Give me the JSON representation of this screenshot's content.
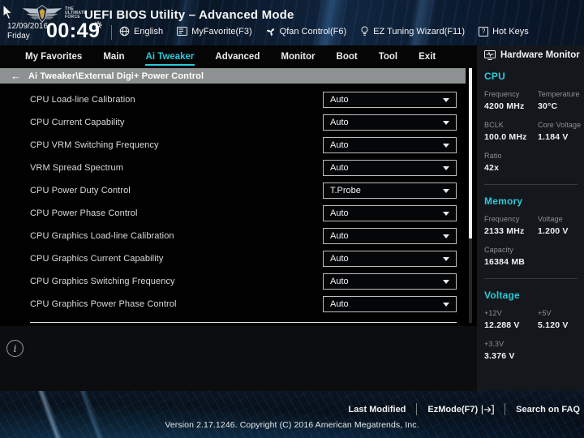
{
  "colors": {
    "accent": "#2bc9da",
    "breadcrumb_bg": "#8e9192",
    "panel_bg": "#010101",
    "sidebar_bg": "#14171b"
  },
  "header": {
    "logo_text": "THE ULTIMATE FORCE",
    "title": "UEFI BIOS Utility – Advanced Mode",
    "date": "12/09/2016",
    "day": "Friday",
    "time": "00:49",
    "actions": [
      {
        "label": "English",
        "icon": "globe-icon"
      },
      {
        "label": "MyFavorite(F3)",
        "icon": "myfavorite-icon"
      },
      {
        "label": "Qfan Control(F6)",
        "icon": "fan-icon"
      },
      {
        "label": "EZ Tuning Wizard(F11)",
        "icon": "bulb-icon"
      },
      {
        "label": "Hot Keys",
        "icon": "question-icon"
      }
    ],
    "question_glyph": "?"
  },
  "menu": {
    "tabs": [
      {
        "label": "My Favorites"
      },
      {
        "label": "Main"
      },
      {
        "label": "Ai Tweaker",
        "active": true
      },
      {
        "label": "Advanced"
      },
      {
        "label": "Monitor"
      },
      {
        "label": "Boot"
      },
      {
        "label": "Tool"
      },
      {
        "label": "Exit"
      }
    ]
  },
  "breadcrumb": {
    "back_icon": "←",
    "path": "Ai Tweaker\\External Digi+ Power Control"
  },
  "settings": {
    "rows": [
      {
        "label": "CPU Load-line Calibration",
        "value": "Auto"
      },
      {
        "label": "CPU Current Capability",
        "value": "Auto"
      },
      {
        "label": "CPU VRM Switching Frequency",
        "value": "Auto"
      },
      {
        "label": "VRM Spread Spectrum",
        "value": "Auto"
      },
      {
        "label": "CPU Power Duty Control",
        "value": "T.Probe"
      },
      {
        "label": "CPU Power Phase Control",
        "value": "Auto"
      },
      {
        "label": "CPU Graphics Load-line Calibration",
        "value": "Auto"
      },
      {
        "label": "CPU Graphics Current Capability",
        "value": "Auto"
      },
      {
        "label": "CPU Graphics Switching Frequency",
        "value": "Auto"
      },
      {
        "label": "CPU Graphics Power Phase Control",
        "value": "Auto"
      }
    ]
  },
  "info": {
    "glyph": "i"
  },
  "hardware_monitor": {
    "title": "Hardware Monitor",
    "cpu": {
      "title": "CPU",
      "items": [
        {
          "label": "Frequency",
          "value": "4200 MHz"
        },
        {
          "label": "Temperature",
          "value": "30°C"
        },
        {
          "label": "BCLK",
          "value": "100.0 MHz"
        },
        {
          "label": "Core Voltage",
          "value": "1.184 V"
        },
        {
          "label": "Ratio",
          "value": "42x"
        }
      ]
    },
    "memory": {
      "title": "Memory",
      "items": [
        {
          "label": "Frequency",
          "value": "2133 MHz"
        },
        {
          "label": "Voltage",
          "value": "1.200 V"
        },
        {
          "label": "Capacity",
          "value": "16384 MB"
        }
      ]
    },
    "voltage": {
      "title": "Voltage",
      "items": [
        {
          "label": "+12V",
          "value": "12.288 V"
        },
        {
          "label": "+5V",
          "value": "5.120 V"
        },
        {
          "label": "+3.3V",
          "value": "3.376 V"
        }
      ]
    }
  },
  "footer": {
    "last_modified": "Last Modified",
    "ezmode": "EzMode(F7)",
    "search_faq": "Search on FAQ",
    "version": "Version 2.17.1246. Copyright (C) 2016 American Megatrends, Inc."
  }
}
